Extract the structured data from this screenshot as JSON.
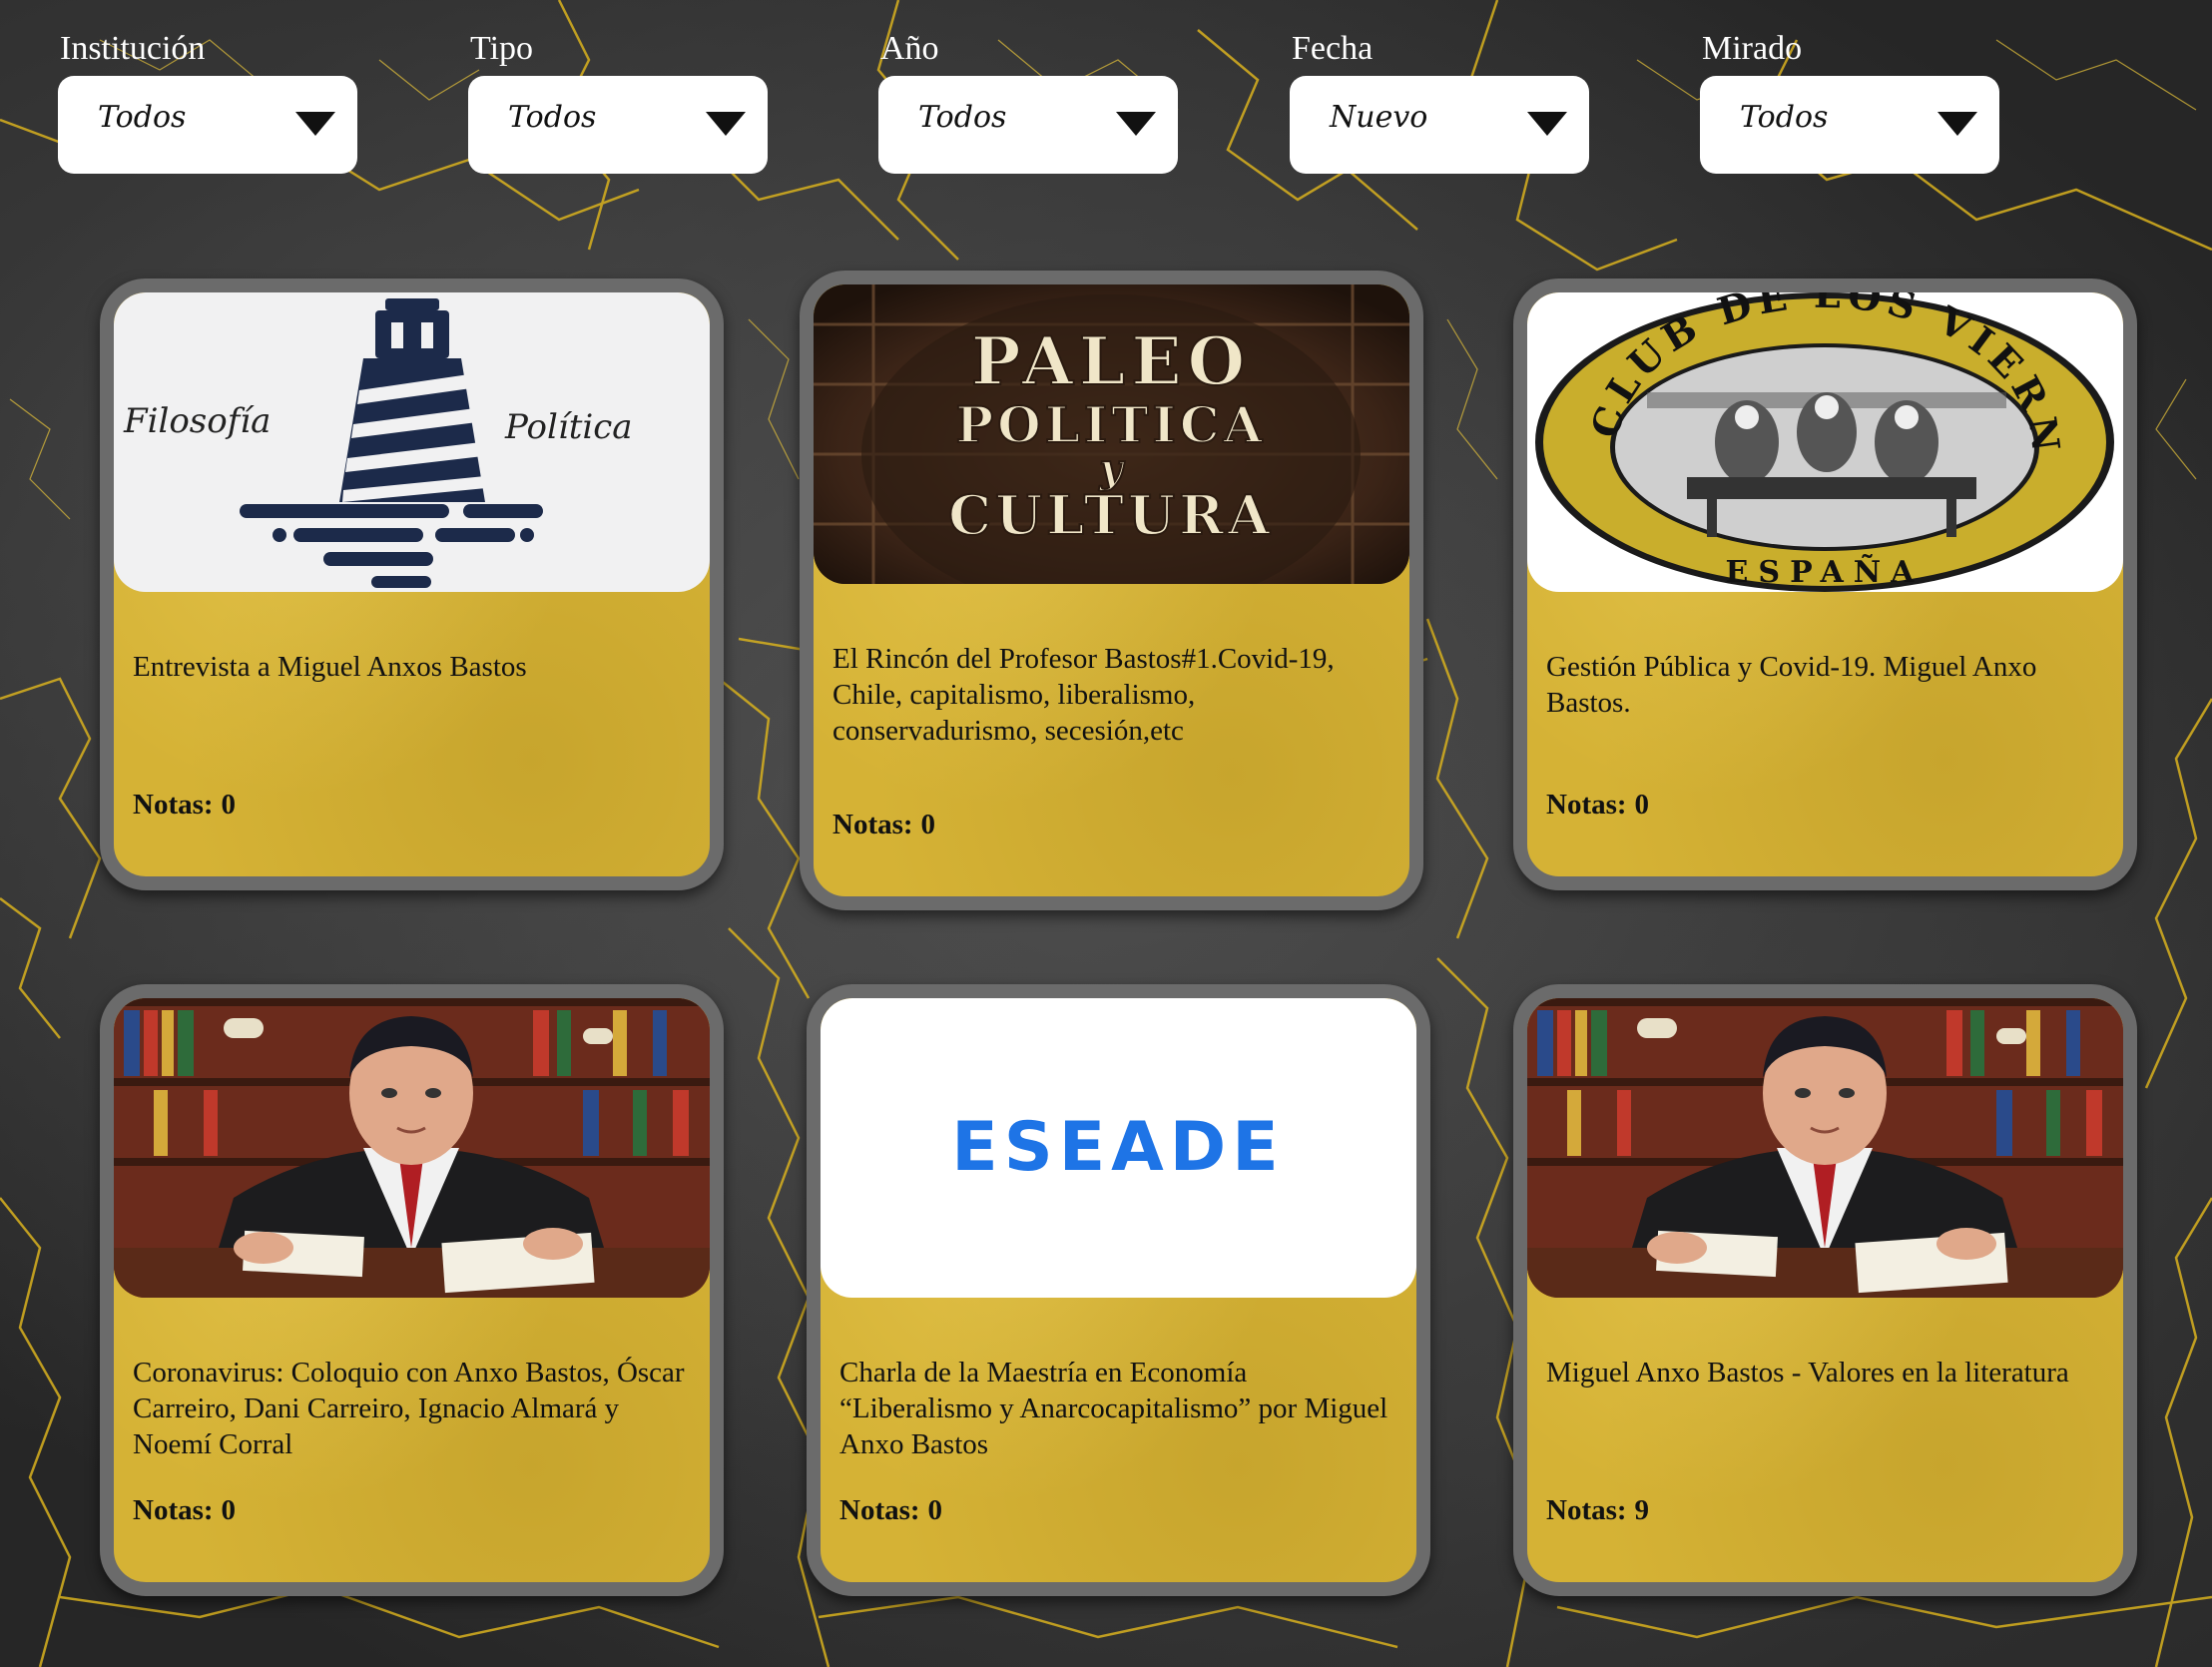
{
  "filters": [
    {
      "label": "Institución",
      "value": "Todos"
    },
    {
      "label": "Tipo",
      "value": "Todos"
    },
    {
      "label": "Año",
      "value": "Todos"
    },
    {
      "label": "Fecha",
      "value": "Nuevo"
    },
    {
      "label": "Mirado",
      "value": "Todos"
    }
  ],
  "notes_label": "Notas:",
  "cards": [
    {
      "title": "Entrevista a Miguel Anxos Bastos",
      "notes": "0",
      "image": {
        "type": "lighthouse-logo",
        "left_text": "Filosofía",
        "right_text": "Política"
      }
    },
    {
      "title": "El Rincón del Profesor Bastos#1.Covid-19, Chile, capitalismo, liberalismo, conservadurismo, secesión,etc",
      "notes": "0",
      "image": {
        "type": "paleo-logo",
        "lines": [
          "PALEO",
          "POLITICA",
          "y",
          "CULTURA"
        ]
      }
    },
    {
      "title": "Gestión Pública y Covid-19. Miguel Anxo Bastos.",
      "notes": "0",
      "image": {
        "type": "club-seal",
        "ring_text": "EL CLUB DE LOS VIERNES",
        "bottom_text": "ESPAÑA"
      }
    },
    {
      "title": "Coronavirus: Coloquio con Anxo Bastos, Óscar Carreiro, Dani Carreiro, Ignacio Almará y Noemí Corral",
      "notes": "0",
      "image": {
        "type": "portrait-painting"
      }
    },
    {
      "title": "Charla de la Maestría en Economía “Liberalismo y Anarcocapitalismo” por Miguel Anxo Bastos",
      "notes": "0",
      "image": {
        "type": "eseade-logo",
        "text": "ESEADE"
      }
    },
    {
      "title": "Miguel Anxo Bastos - Valores en la literatura",
      "notes": "9",
      "image": {
        "type": "portrait-painting"
      }
    }
  ],
  "colors": {
    "card_fill": "#d5b235",
    "card_border": "#6b6b6b",
    "crack_gold": "#d9b21e",
    "eseade_blue": "#1e74e6",
    "lighthouse_navy": "#1c2a4a",
    "seal_gold": "#c9ae2c"
  }
}
